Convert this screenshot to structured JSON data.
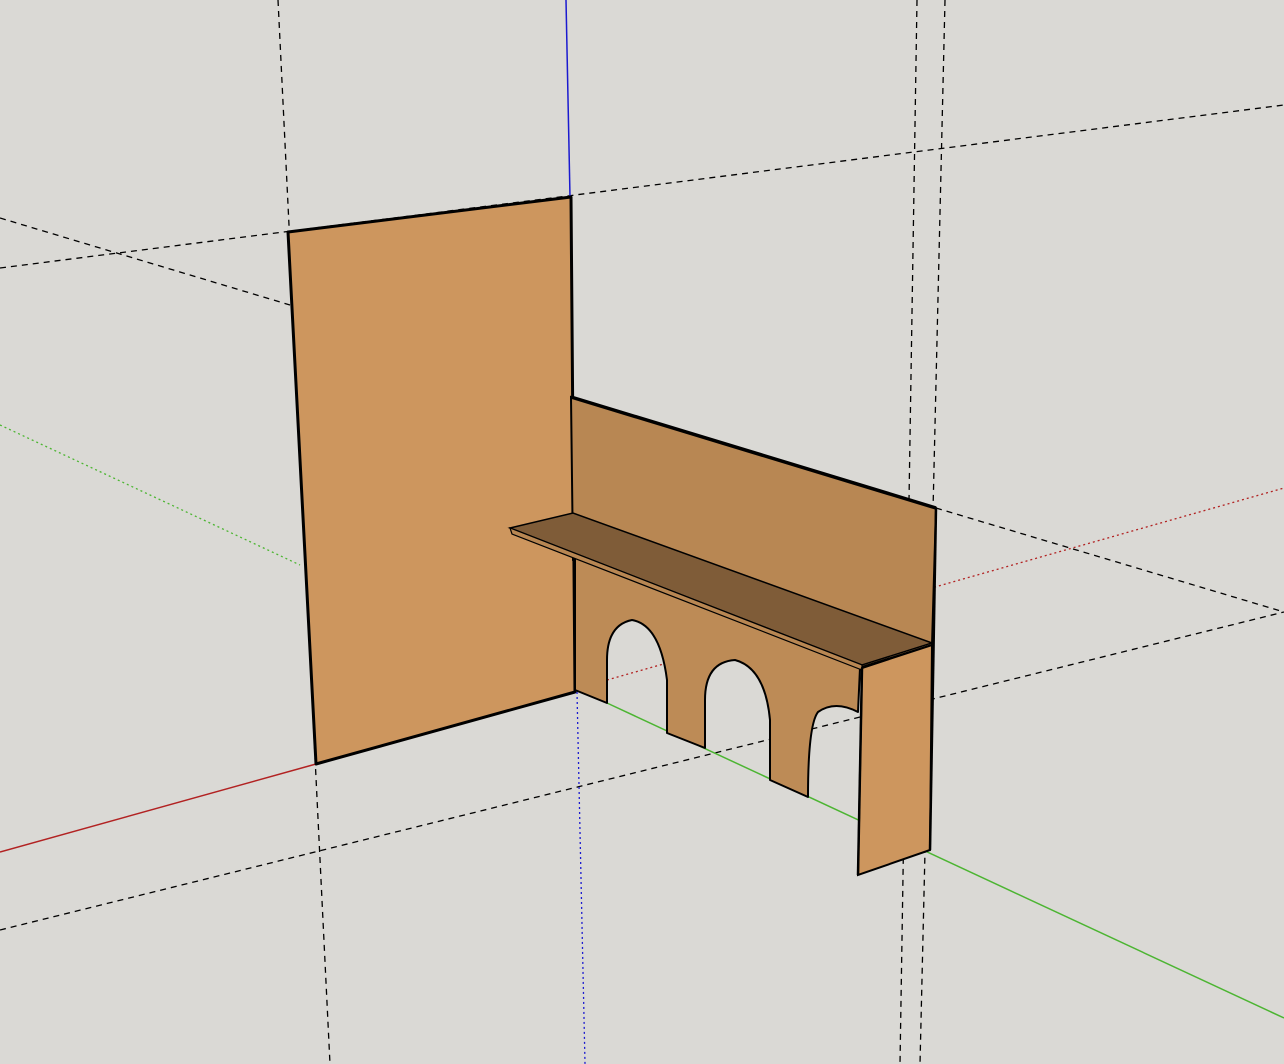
{
  "viewport": {
    "background": "#dad9d5",
    "colors": {
      "face_light": "#cd965e",
      "face_back": "#b88753",
      "face_lower": "#bd8b56",
      "shelf_top": "#7f5c38",
      "edge": "#000000",
      "axis_red": "#b22222",
      "axis_green": "#4cb532",
      "axis_blue": "#1a1ad0",
      "guide": "#000000"
    }
  }
}
